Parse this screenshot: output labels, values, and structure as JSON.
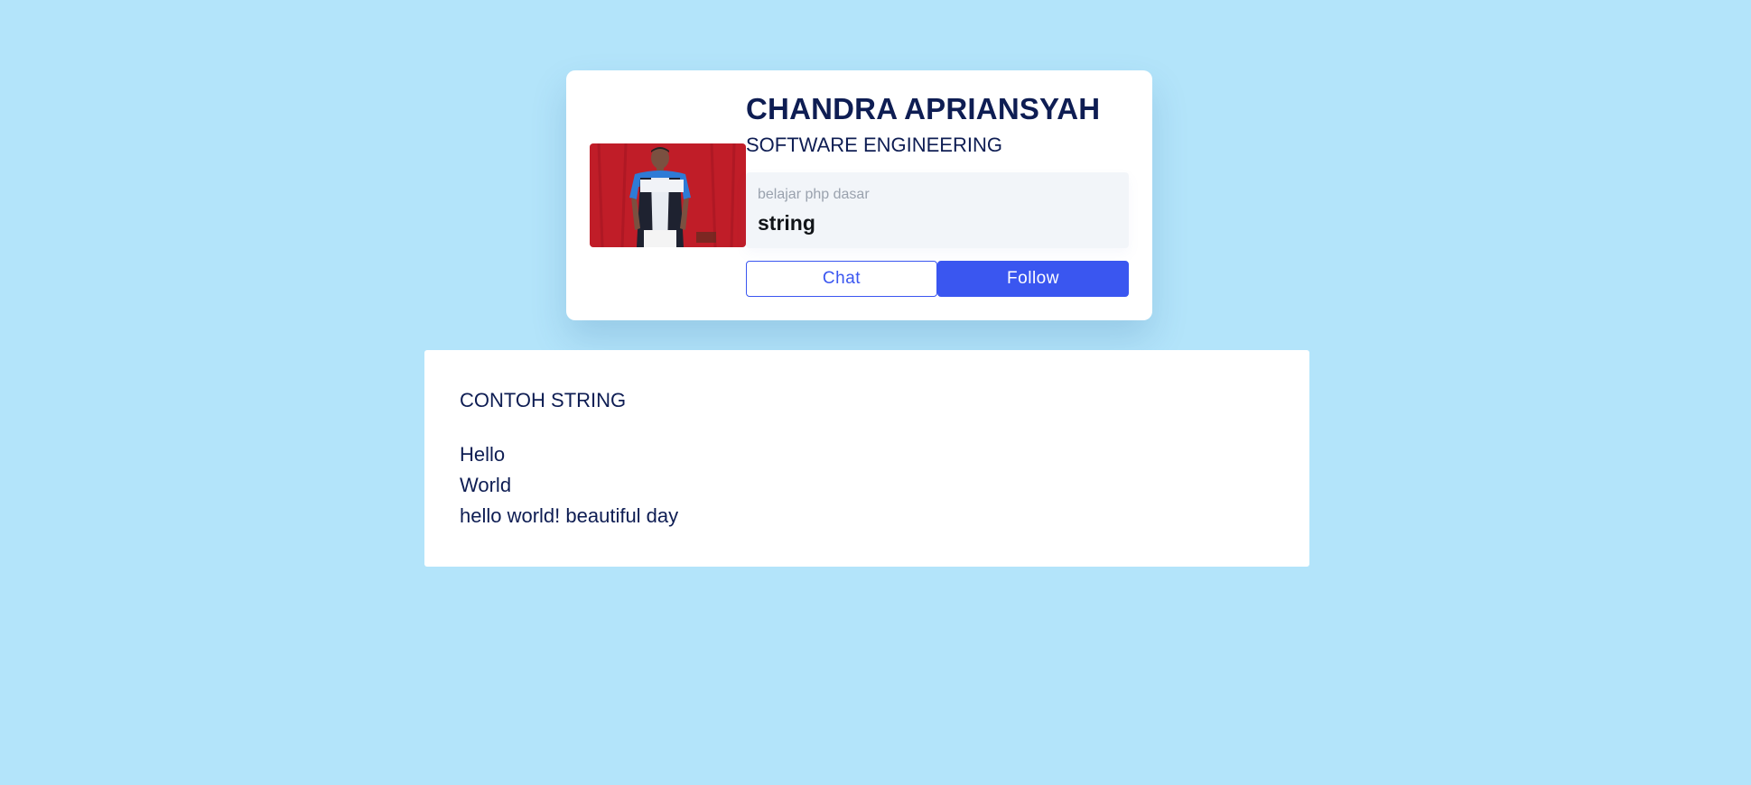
{
  "profile": {
    "name": "CHANDRA APRIANSYAH",
    "role": "SOFTWARE ENGINEERING",
    "info_label": "belajar php dasar",
    "info_value": "string",
    "chat_label": "Chat",
    "follow_label": "Follow",
    "photo_icon": "profile-photo"
  },
  "content": {
    "title": "CONTOH STRING",
    "lines": [
      "Hello",
      "World",
      "hello world! beautiful day"
    ]
  },
  "colors": {
    "background": "#b3e4fa",
    "text_dark": "#0e1d53",
    "accent": "#3a56f0",
    "photo_backdrop": "#c8202b"
  }
}
